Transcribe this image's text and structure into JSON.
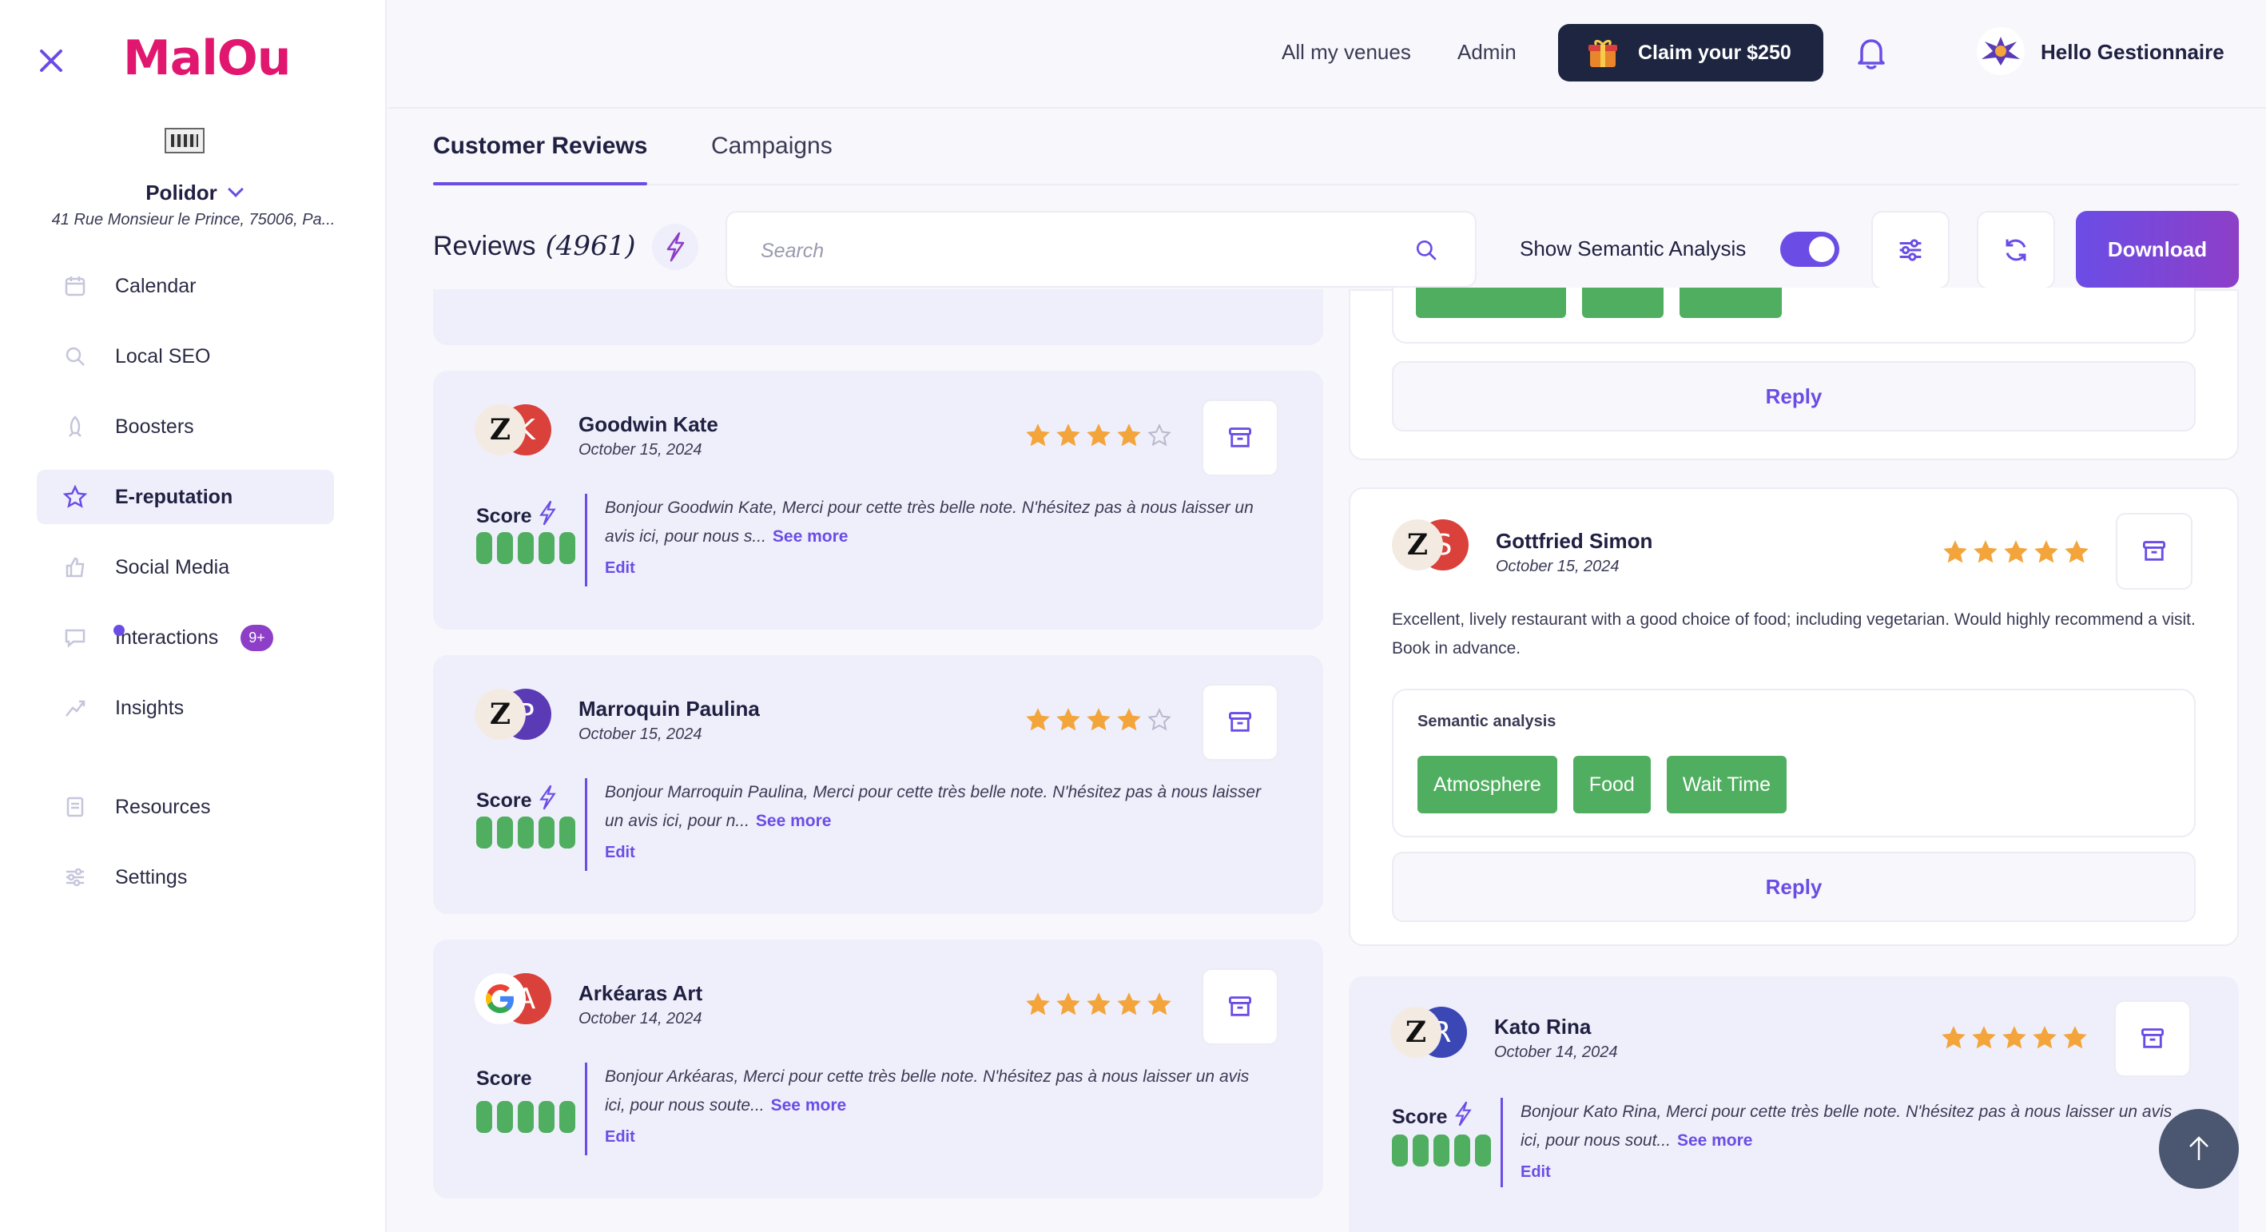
{
  "brand": {
    "logo_text": "MalOu"
  },
  "venue": {
    "name": "Polidor",
    "address": "41 Rue Monsieur le Prince, 75006, Pa..."
  },
  "sidebar": {
    "items": [
      {
        "label": "Calendar",
        "icon": "calendar-icon"
      },
      {
        "label": "Local SEO",
        "icon": "search-icon"
      },
      {
        "label": "Boosters",
        "icon": "rocket-icon"
      },
      {
        "label": "E-reputation",
        "icon": "star-icon",
        "active": true
      },
      {
        "label": "Social Media",
        "icon": "thumbs-up-icon"
      },
      {
        "label": "Interactions",
        "icon": "chat-icon",
        "badge": "9+"
      },
      {
        "label": "Insights",
        "icon": "trend-icon"
      },
      {
        "label": "Resources",
        "icon": "document-icon"
      },
      {
        "label": "Settings",
        "icon": "sliders-icon"
      }
    ]
  },
  "header": {
    "links": [
      "All my venues",
      "Admin"
    ],
    "claim_label": "Claim your $250",
    "greeting": "Hello Gestionnaire"
  },
  "tabs": [
    "Customer Reviews",
    "Campaigns"
  ],
  "toolbar": {
    "reviews_label": "Reviews",
    "reviews_count": "(4961)",
    "search_placeholder": "Search",
    "semantic_label": "Show Semantic Analysis",
    "semantic_on": true,
    "download_label": "Download"
  },
  "labels": {
    "score": "Score",
    "see_more": "See more",
    "edit": "Edit",
    "reply": "Reply",
    "semantic_analysis": "Semantic analysis"
  },
  "colors": {
    "accent": "#6b4de6",
    "star": "#f3a53c",
    "score_green": "#4fae5f",
    "dark_button": "#1d2540"
  },
  "left_reviews": [
    {
      "initial": "K",
      "avatar_color": "#d9413a",
      "name": "Goodwin Kate",
      "date": "October 15, 2024",
      "rating": 4,
      "reply": "Bonjour Goodwin Kate, Merci pour cette très belle note. N'hésitez pas à nous laisser un avis ici, pour nous s...",
      "platform": "zenchef"
    },
    {
      "initial": "P",
      "avatar_color": "#5b3bb5",
      "name": "Marroquin Paulina",
      "date": "October 15, 2024",
      "rating": 4,
      "reply": "Bonjour Marroquin Paulina, Merci pour cette très belle note. N'hésitez pas à nous laisser un avis ici, pour n...",
      "platform": "zenchef"
    },
    {
      "initial": "A",
      "avatar_color": "#d9413a",
      "name": "Arkéaras Art",
      "date": "October 14, 2024",
      "rating": 5,
      "reply": "Bonjour Arkéaras, Merci pour cette très belle note. N'hésitez pas à nous laisser un avis ici, pour nous soute...",
      "platform": "google"
    }
  ],
  "right_reviews": [
    {
      "initial": "S",
      "avatar_color": "#d9413a",
      "name": "Gottfried Simon",
      "date": "October 15, 2024",
      "rating": 5,
      "text": "Excellent, lively restaurant with a good choice of food; including vegetarian. Would highly recommend a visit. Book in advance.",
      "tags": [
        "Atmosphere",
        "Food",
        "Wait Time"
      ]
    },
    {
      "initial": "R",
      "avatar_color": "#3b47b5",
      "name": "Kato Rina",
      "date": "October 14, 2024",
      "rating": 5,
      "reply": "Bonjour Kato Rina, Merci pour cette très belle note. N'hésitez pas à nous laisser un avis ici, pour nous sout..."
    }
  ]
}
